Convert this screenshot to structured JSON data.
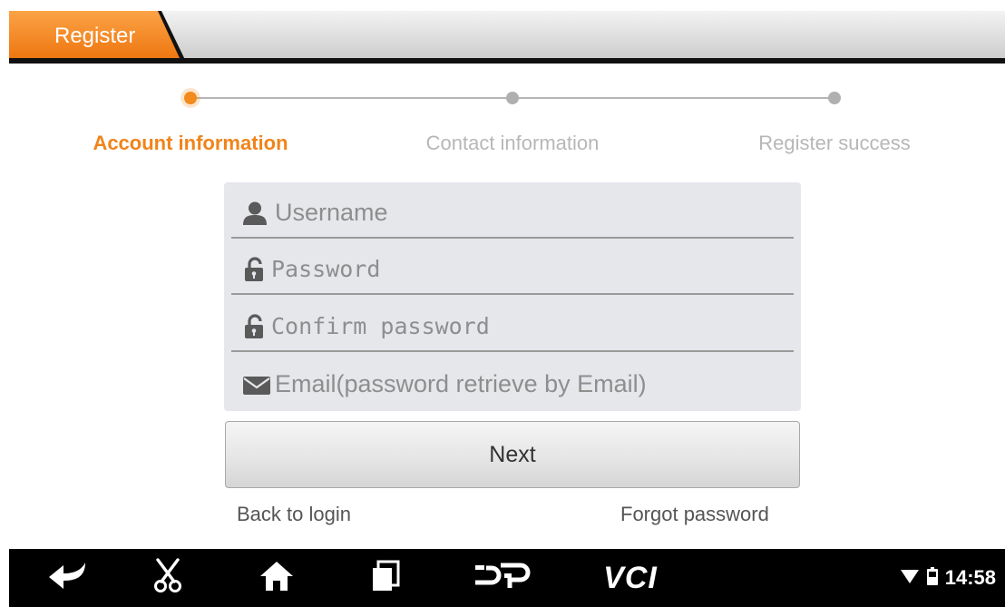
{
  "header": {
    "tab_label": "Register",
    "accent_color": "#f28a1d"
  },
  "stepper": {
    "steps": [
      {
        "label": "Account information",
        "state": "active"
      },
      {
        "label": "Contact information",
        "state": "inactive"
      },
      {
        "label": "Register success",
        "state": "inactive"
      }
    ]
  },
  "form": {
    "fields": [
      {
        "placeholder": "Username",
        "icon": "user-icon",
        "value": ""
      },
      {
        "placeholder": "Password",
        "icon": "lock-icon",
        "value": ""
      },
      {
        "placeholder": "Confirm password",
        "icon": "lock-icon",
        "value": ""
      },
      {
        "placeholder": "Email(password retrieve by Email)",
        "icon": "envelope-icon",
        "value": ""
      }
    ],
    "next_label": "Next",
    "back_to_login": "Back to login",
    "forgot_password": "Forgot password"
  },
  "navbar": {
    "items": [
      "back-icon",
      "scissors-icon",
      "home-icon",
      "recent-apps-icon",
      "dp-icon",
      "vci-icon"
    ],
    "vci_label": "VCI",
    "status": {
      "wifi": "wifi-icon",
      "battery": "battery-icon",
      "time": "14:58"
    }
  }
}
